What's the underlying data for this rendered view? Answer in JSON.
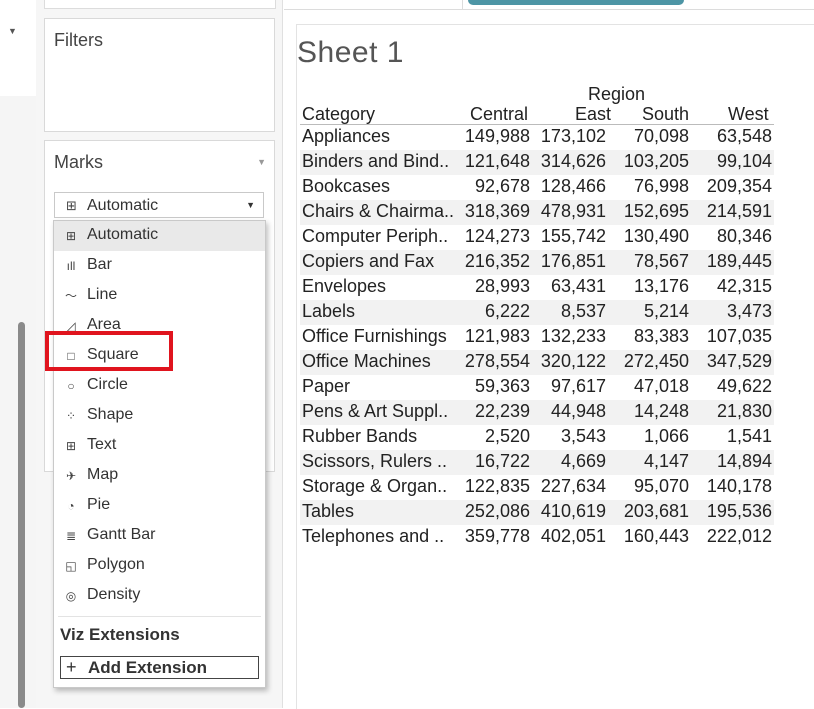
{
  "filters": {
    "title": "Filters"
  },
  "marks": {
    "title": "Marks",
    "selected_mark_type": "Automatic",
    "options": [
      {
        "label": "Automatic",
        "icon": "text-t-icon"
      },
      {
        "label": "Bar",
        "icon": "bar-icon"
      },
      {
        "label": "Line",
        "icon": "line-icon"
      },
      {
        "label": "Area",
        "icon": "area-icon"
      },
      {
        "label": "Square",
        "icon": "square-icon"
      },
      {
        "label": "Circle",
        "icon": "circle-icon"
      },
      {
        "label": "Shape",
        "icon": "shape-icon"
      },
      {
        "label": "Text",
        "icon": "text-t-icon"
      },
      {
        "label": "Map",
        "icon": "map-icon"
      },
      {
        "label": "Pie",
        "icon": "pie-icon"
      },
      {
        "label": "Gantt Bar",
        "icon": "gantt-icon"
      },
      {
        "label": "Polygon",
        "icon": "polygon-icon"
      },
      {
        "label": "Density",
        "icon": "density-icon"
      }
    ],
    "viz_extensions_label": "Viz Extensions",
    "add_extension_label": "Add Extension"
  },
  "sheet": {
    "title": "Sheet 1"
  },
  "crosstab": {
    "region_header": "Region",
    "row_header": "Category",
    "columns": [
      "Central",
      "East",
      "South",
      "West"
    ],
    "rows": [
      {
        "category": "Appliances",
        "values": [
          "149,988",
          "173,102",
          "70,098",
          "63,548"
        ]
      },
      {
        "category": "Binders and Bind..",
        "values": [
          "121,648",
          "314,626",
          "103,205",
          "99,104"
        ]
      },
      {
        "category": "Bookcases",
        "values": [
          "92,678",
          "128,466",
          "76,998",
          "209,354"
        ]
      },
      {
        "category": "Chairs & Chairma..",
        "values": [
          "318,369",
          "478,931",
          "152,695",
          "214,591"
        ]
      },
      {
        "category": "Computer Periph..",
        "values": [
          "124,273",
          "155,742",
          "130,490",
          "80,346"
        ]
      },
      {
        "category": "Copiers and Fax",
        "values": [
          "216,352",
          "176,851",
          "78,567",
          "189,445"
        ]
      },
      {
        "category": "Envelopes",
        "values": [
          "28,993",
          "63,431",
          "13,176",
          "42,315"
        ]
      },
      {
        "category": "Labels",
        "values": [
          "6,222",
          "8,537",
          "5,214",
          "3,473"
        ]
      },
      {
        "category": "Office Furnishings",
        "values": [
          "121,983",
          "132,233",
          "83,383",
          "107,035"
        ]
      },
      {
        "category": "Office Machines",
        "values": [
          "278,554",
          "320,122",
          "272,450",
          "347,529"
        ]
      },
      {
        "category": "Paper",
        "values": [
          "59,363",
          "97,617",
          "47,018",
          "49,622"
        ]
      },
      {
        "category": "Pens & Art Suppl..",
        "values": [
          "22,239",
          "44,948",
          "14,248",
          "21,830"
        ]
      },
      {
        "category": "Rubber Bands",
        "values": [
          "2,520",
          "3,543",
          "1,066",
          "1,541"
        ]
      },
      {
        "category": "Scissors, Rulers ..",
        "values": [
          "16,722",
          "4,669",
          "4,147",
          "14,894"
        ]
      },
      {
        "category": "Storage & Organ..",
        "values": [
          "122,835",
          "227,634",
          "95,070",
          "140,178"
        ]
      },
      {
        "category": "Tables",
        "values": [
          "252,086",
          "410,619",
          "203,681",
          "195,536"
        ]
      },
      {
        "category": "Telephones and ..",
        "values": [
          "359,778",
          "402,051",
          "160,443",
          "222,012"
        ]
      }
    ]
  },
  "colors": {
    "highlight": "#e0141e",
    "accent_pill": "#4d95a5"
  }
}
